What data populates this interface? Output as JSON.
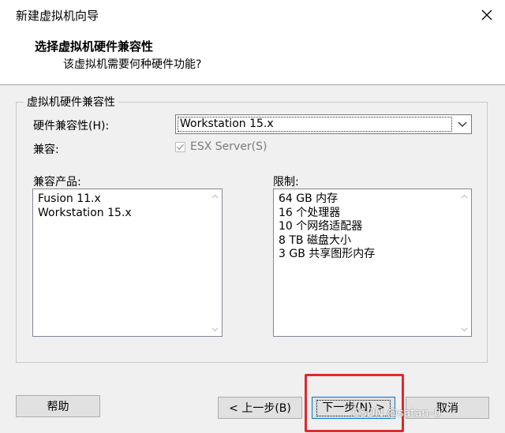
{
  "window": {
    "title": "新建虚拟机向导"
  },
  "header": {
    "title": "选择虚拟机硬件兼容性",
    "subtitle": "该虚拟机需要何种硬件功能?"
  },
  "group": {
    "legend": "虚拟机硬件兼容性",
    "hw_compat_label": "硬件兼容性(H):",
    "hw_compat_value": "Workstation 15.x",
    "compat_label": "兼容:",
    "esx_label": "ESX Server(S)",
    "esx_checked": true,
    "products_label": "兼容产品:",
    "products": [
      "Fusion 11.x",
      "Workstation 15.x"
    ],
    "limits_label": "限制:",
    "limits": [
      "64 GB 内存",
      "16 个处理器",
      "10 个网络适配器",
      "8 TB 磁盘大小",
      "3 GB 共享图形内存"
    ]
  },
  "buttons": {
    "help": "帮助",
    "back": "< 上一步(B)",
    "next": "下一步(N) >",
    "cancel": "取消"
  },
  "watermark": "CSDN @satan–0",
  "colors": {
    "highlight": "#e0282e",
    "default_button_border": "#0078d7"
  }
}
